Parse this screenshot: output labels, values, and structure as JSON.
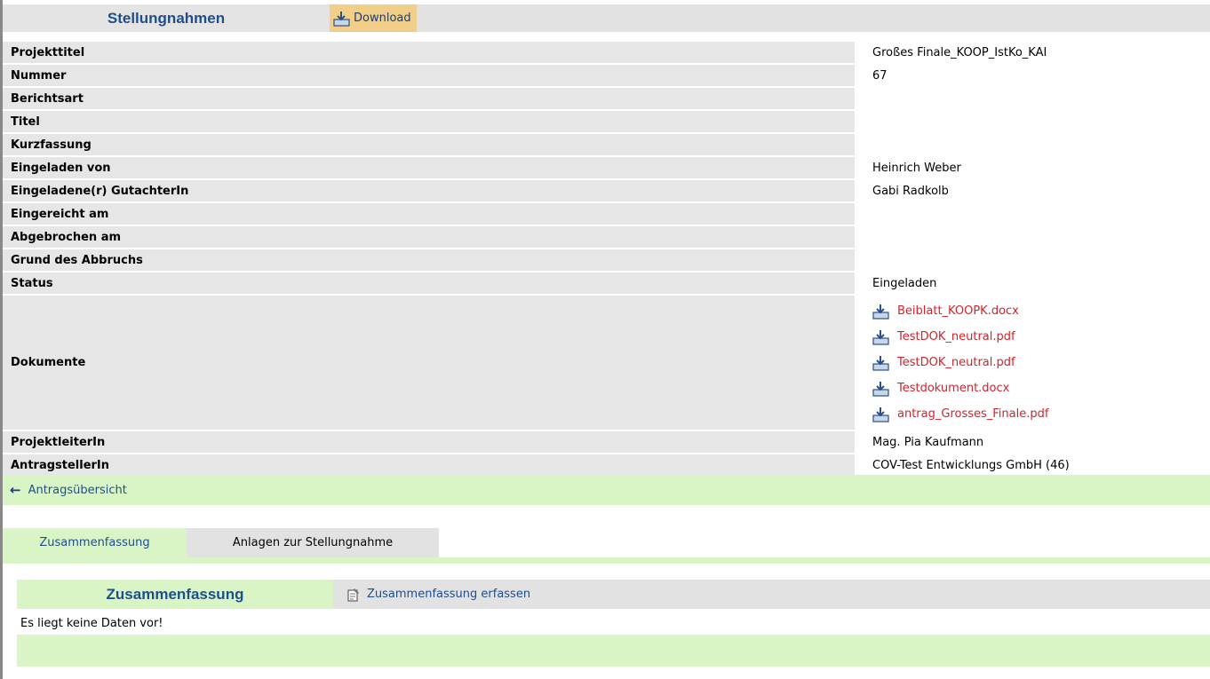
{
  "header": {
    "title": "Stellungnahmen",
    "download_label": "Download"
  },
  "details": [
    {
      "label": "Projekttitel",
      "value": "Großes Finale_KOOP_IstKo_KAI"
    },
    {
      "label": "Nummer",
      "value": "67"
    },
    {
      "label": "Berichtsart",
      "value": ""
    },
    {
      "label": "Titel",
      "value": ""
    },
    {
      "label": "Kurzfassung",
      "value": ""
    },
    {
      "label": "Eingeladen von",
      "value": "Heinrich Weber"
    },
    {
      "label": "Eingeladene(r) GutachterIn",
      "value": "Gabi Radkolb"
    },
    {
      "label": "Eingereicht am",
      "value": ""
    },
    {
      "label": "Abgebrochen am",
      "value": ""
    },
    {
      "label": "Grund des Abbruchs",
      "value": ""
    },
    {
      "label": "Status",
      "value": "Eingeladen"
    }
  ],
  "documents": {
    "label": "Dokumente",
    "files": [
      "Beiblatt_KOOPK.docx",
      "TestDOK_neutral.pdf",
      "TestDOK_neutral.pdf",
      "Testdokument.docx",
      "antrag_Grosses_Finale.pdf"
    ]
  },
  "details_after": [
    {
      "label": "ProjektleiterIn",
      "value": "Mag. Pia Kaufmann"
    },
    {
      "label": "AntragstellerIn",
      "value": "COV-Test Entwicklungs GmbH (46)"
    }
  ],
  "back_link": "Antragsübersicht",
  "tabs": [
    {
      "label": "Zusammenfassung",
      "active": true
    },
    {
      "label": "Anlagen zur Stellungnahme",
      "active": false
    }
  ],
  "summary": {
    "title": "Zusammenfassung",
    "capture_label": "Zusammenfassung erfassen",
    "empty_message": "Es liegt keine Daten vor!"
  },
  "colors": {
    "header_title": "#1f4e8c",
    "header_bg": "#e2e2e2",
    "download_bg": "#f2cf88",
    "green_bar": "#d9f5c6",
    "doc_link": "#d2232a",
    "label_bg": "#e6e6e6"
  }
}
